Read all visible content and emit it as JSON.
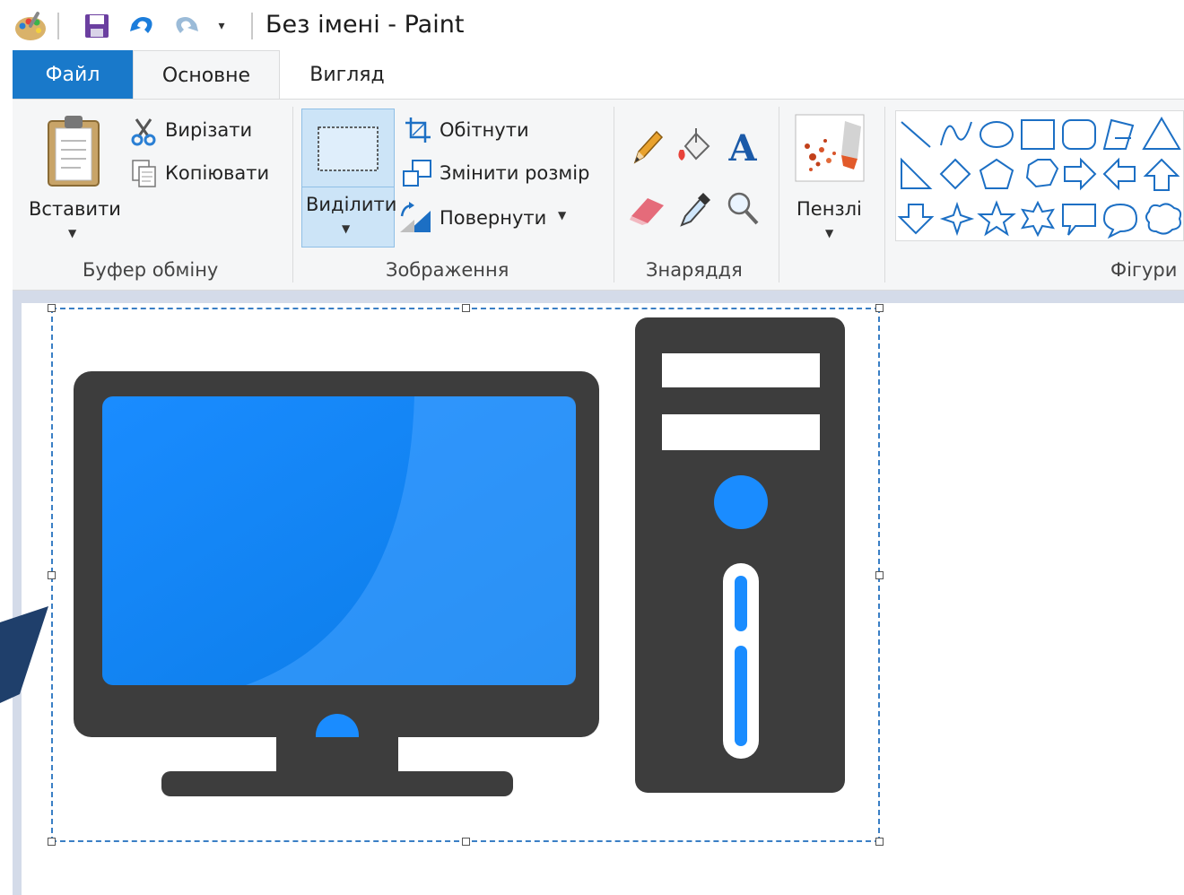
{
  "window": {
    "title": "Без імені - Paint"
  },
  "quick_access": {
    "icons": [
      "paint-app-icon",
      "save-icon",
      "undo-icon",
      "redo-icon",
      "customize-dropdown-icon"
    ]
  },
  "tabs": [
    {
      "label": "Файл",
      "active": false
    },
    {
      "label": "Основне",
      "active": true
    },
    {
      "label": "Вигляд",
      "active": false
    }
  ],
  "ribbon": {
    "clipboard": {
      "paste_label": "Вставити",
      "cut_label": "Вирізати",
      "copy_label": "Копіювати",
      "group_label": "Буфер обміну"
    },
    "image": {
      "select_label": "Виділити",
      "crop_label": "Обітнути",
      "resize_label": "Змінити розмір",
      "rotate_label": "Повернути",
      "group_label": "Зображення"
    },
    "tools": {
      "icons": [
        "pencil-icon",
        "fill-icon",
        "text-icon",
        "eraser-icon",
        "color-picker-icon",
        "magnifier-icon"
      ],
      "text_tool_glyph": "A",
      "group_label": "Знаряддя"
    },
    "brushes": {
      "label": "Пензлі"
    },
    "shapes": {
      "group_label": "Фігури"
    }
  },
  "colors": {
    "accent": "#1979ca",
    "ribbon_bg": "#f5f6f7",
    "selected_bg": "#cce4f7",
    "workspace_bg": "#d4dbe9",
    "computer_body": "#3d3d3d",
    "screen_blue": "#1a8cff",
    "callout": "#1f3f6b"
  }
}
